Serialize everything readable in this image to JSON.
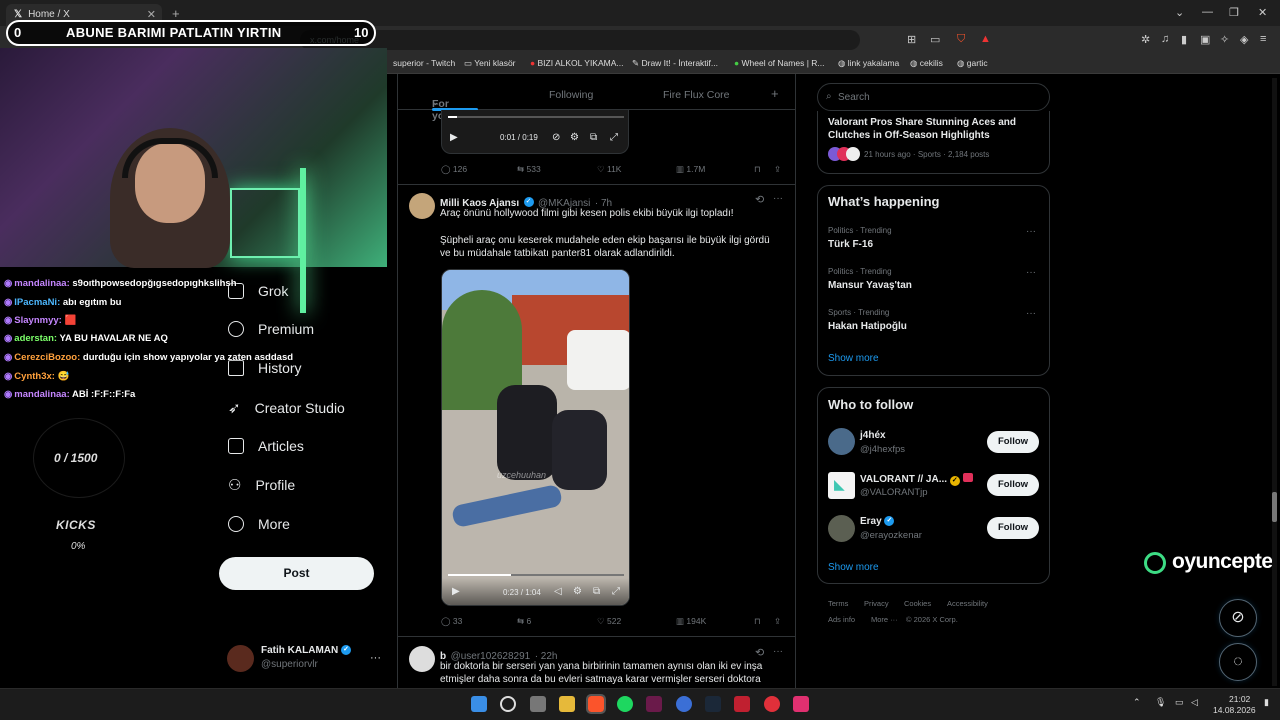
{
  "browser": {
    "tab_title": "Home / X",
    "tab_close": "✕",
    "new_tab": "+",
    "url": "x.com/home",
    "window_controls": [
      "⌄",
      "—",
      "❐",
      "✕"
    ],
    "bookmarks": [
      "superior - Twitch",
      "Yeni klasör",
      "BIZI ALKOL YIKAMA...",
      "Draw It! - İnteraktif...",
      "Wheel of Names | R...",
      "link yakalama",
      "cekilis",
      "gartic"
    ]
  },
  "stream": {
    "banner_left": "0",
    "banner_text": "ABUNE BARIMI PATLATIN YIRTIN",
    "banner_right": "10",
    "chat": [
      {
        "user": "mandalinaa:",
        "msg": "s9oıthpowsedopğıgsedopıghkslihsh",
        "cls": "user"
      },
      {
        "user": "IPacmaNi:",
        "msg": "abı egıtım bu",
        "cls": "u2"
      },
      {
        "user": "Slaynmyy:",
        "msg": "🟥",
        "cls": "user"
      },
      {
        "user": "aderstan:",
        "msg": "YA BU HAVALAR NE AQ",
        "cls": "u3"
      },
      {
        "user": "CerezciBozoo:",
        "msg": "durduğu için show yapıyolar ya zaten asddasd",
        "cls": "u4"
      },
      {
        "user": "Cynth3x:",
        "msg": "😅",
        "cls": "u4"
      },
      {
        "user": "mandalinaa:",
        "msg": "ABİ :F:F::F:Fa",
        "cls": "user"
      }
    ],
    "goal": "0 / 1500",
    "kicks_label": "KICKS",
    "kicks_pct": "0%",
    "brand": "oyuncepte"
  },
  "nav": {
    "items": [
      "Grok",
      "Premium",
      "History",
      "Creator Studio",
      "Articles",
      "Profile",
      "More"
    ],
    "post_button": "Post",
    "account_name": "Fatih KALAMAN",
    "account_handle": "@superiorvlr",
    "account_more": "···"
  },
  "feed": {
    "tabs": [
      "For you",
      "Following",
      "Fire Flux Core"
    ],
    "add_tab": "+",
    "first_video": {
      "time": "0:01 / 0:19",
      "progress": 0.05
    },
    "first_actions": {
      "replies": "126",
      "reposts": "533",
      "likes": "11K",
      "views": "1.7M"
    },
    "tweet": {
      "name": "Milli Kaos Ajansı",
      "handle": "@MKAjansi",
      "time": "· 7h",
      "more": "···",
      "line1": "Araç önünü hollywood filmi gibi kesen polis ekibi büyük ilgi topladı!",
      "line2": "Şüpheli araç onu keserek mudahele eden ekip başarısı ile büyük ilgi gördü",
      "line3": "ve bu müdahale tatbikatı panter81 olarak adlandirildi.",
      "video_time": "0:23 / 1:04",
      "progress": 0.36,
      "watermark": "uzcehuuhan"
    },
    "tweet_actions": {
      "replies": "33",
      "reposts": "6",
      "likes": "522",
      "views": "194K"
    },
    "tweet2": {
      "name": "b",
      "handle": "@user102628291",
      "time": "· 22h",
      "more": "···",
      "line1": "bir doktorla bir serseri yan yana birbirinin tamamen aynısı olan iki ev inşa",
      "line2": "etmişler daha sonra da bu evleri satmaya karar vermişler serseri doktora"
    }
  },
  "right": {
    "search_placeholder": "Search",
    "top_story": {
      "title_line1": "Valorant Pros Share Stunning Aces and",
      "title_line2": "Clutches in Off-Season Highlights",
      "meta": "21 hours ago · Sports · 2,184 posts"
    },
    "happening_title": "What’s happening",
    "trends": [
      {
        "meta": "Politics · Trending",
        "title": "Türk F-16"
      },
      {
        "meta": "Politics · Trending",
        "title": "Mansur Yavaş'tan"
      },
      {
        "meta": "Sports · Trending",
        "title": "Hakan Hatipoğlu"
      }
    ],
    "trend_more": "···",
    "show_more": "Show more",
    "follow_title": "Who to follow",
    "follow": [
      {
        "name": "j4héx",
        "handle": "@j4hexfps"
      },
      {
        "name": "VALORANT // JA...",
        "handle": "@VALORANTjp"
      },
      {
        "name": "Eray",
        "handle": "@erayozkenar"
      }
    ],
    "follow_label": "Follow",
    "follow_show_more": "Show more",
    "footer_row1": [
      "Terms",
      "Privacy",
      "Cookies",
      "Accessibility"
    ],
    "footer_row2": [
      "Ads info",
      "More ···",
      "© 2026 X Corp."
    ]
  },
  "taskbar": {
    "time": "21:02",
    "date": "14.08.2026"
  },
  "colors": {
    "accent": "#1d9bf0",
    "background": "#000000",
    "brand_green": "#3ddc84"
  }
}
